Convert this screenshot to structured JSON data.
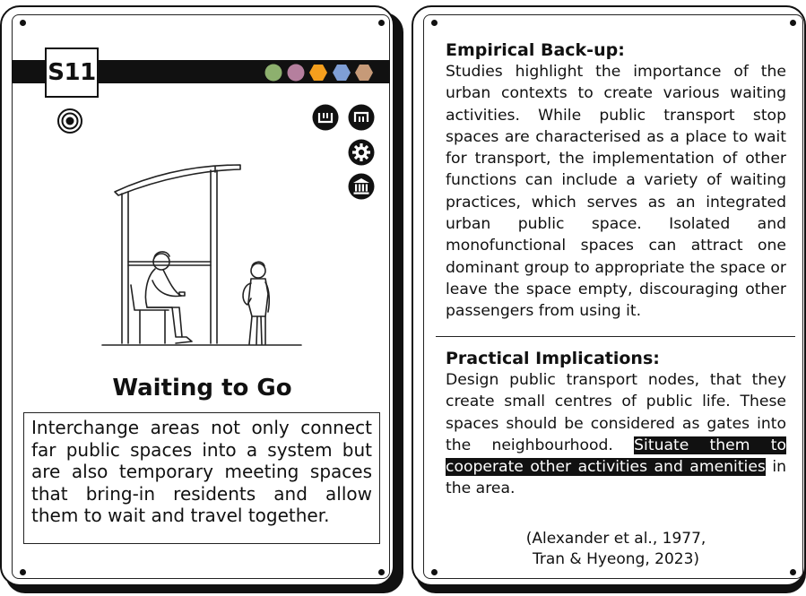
{
  "left_card": {
    "code": "S11",
    "chips": [
      {
        "name": "green-circle-chip",
        "shape": "circle",
        "color": "#8db06e"
      },
      {
        "name": "mauve-circle-chip",
        "shape": "circle",
        "color": "#b57f9e"
      },
      {
        "name": "orange-hexagon-chip",
        "shape": "hexagon",
        "color": "#f59f1d"
      },
      {
        "name": "blue-hexagon-chip",
        "shape": "hexagon",
        "color": "#7f9fd6"
      },
      {
        "name": "tan-hexagon-chip",
        "shape": "hexagon",
        "color": "#c69a78"
      }
    ],
    "icons": [
      "target-icon",
      "stop-in-icon",
      "stop-out-icon",
      "gear-icon",
      "institution-icon"
    ],
    "illustration": "bus-stop-shelter-with-seated-man-and-child",
    "title": "Waiting to Go",
    "description": "Interchange areas not only connect far public spaces into a system but are also temporary meeting spaces that bring-in residents and allow them to wait and travel together."
  },
  "right_card": {
    "empirical_heading": "Empirical Back-up:",
    "empirical_text": "Studies highlight the importance of the urban contexts to create various waiting activities. While public transport stop spaces are characterised as a place to wait for transport, the implementation of other functions can include a variety of waiting practices, which serves as an integrated urban public space. Isolated and monofunctional spaces can attract one dominant group to appropriate the space or leave the space empty, discouraging other passengers from using it.",
    "practical_heading": "Practical Implications:",
    "practical_text_before": "Design public transport nodes, that they create small centres of public life. These spaces should be considered as gates into the neighbourhood. ",
    "practical_text_highlight": "Situate them to cooperate other activities and amenities",
    "practical_text_after": " in the area.",
    "citation_line1": "(Alexander et al., 1977,",
    "citation_line2": "Tran & Hyeong, 2023)"
  }
}
